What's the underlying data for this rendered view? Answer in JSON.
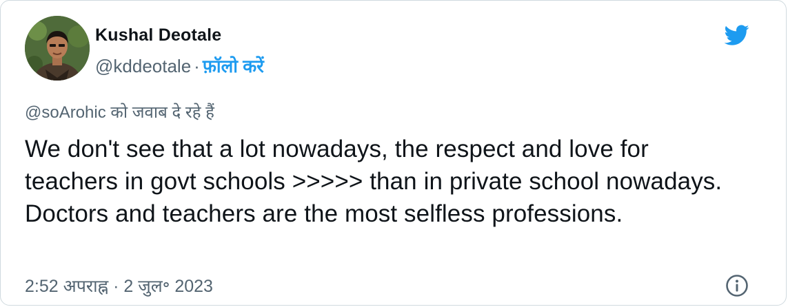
{
  "author": {
    "display_name": "Kushal Deotale",
    "handle": "@kddeotale",
    "separator": "·",
    "follow_label": "फ़ॉलो करें"
  },
  "reply_context": {
    "text": "@soArohic को जवाब दे रहे हैं"
  },
  "tweet": {
    "text": "We don't see that a lot nowadays, the respect and love for teachers in govt schools >>>>> than in private school nowadays. Doctors and teachers are the most selfless professions."
  },
  "meta": {
    "timestamp": "2:52 अपराह्न · 2 जुल॰ 2023"
  },
  "icons": {
    "brand": "twitter-bird-icon",
    "info": "info-icon",
    "brand_color": "#1d9bf0"
  }
}
